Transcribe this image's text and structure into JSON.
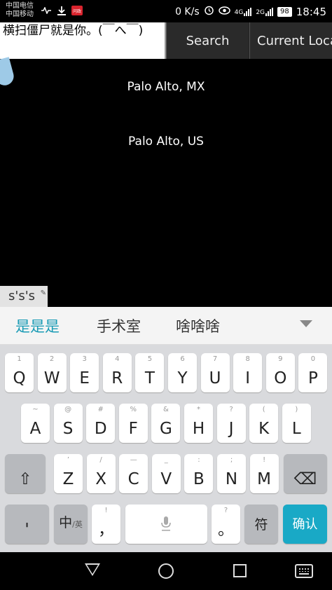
{
  "status_bar": {
    "carrier1": "中国电信",
    "carrier2": "中国移动",
    "net_speed": "0 K/s",
    "net1": "4G",
    "net2": "2G",
    "battery": "98",
    "time": "18:45",
    "icons": [
      "pulse-icon",
      "download-icon",
      "app-badge-icon",
      "alarm-icon",
      "eye-icon",
      "signal-icon",
      "battery-icon"
    ],
    "app_badge_text": "问政"
  },
  "top_bar": {
    "input_value": "横扫僵尸就是你。(￣へ￣)",
    "search_label": "Search",
    "location_label": "Current Location"
  },
  "results": [
    {
      "label": "Palo Alto, MX"
    },
    {
      "label": "Palo Alto, US"
    }
  ],
  "ime": {
    "composing": "s's's",
    "candidates": [
      "是是是",
      "手术室",
      "啥啥啥"
    ],
    "accent_color": "#19a9c6"
  },
  "keyboard": {
    "row1": [
      {
        "hint": "1",
        "label": "Q"
      },
      {
        "hint": "2",
        "label": "W"
      },
      {
        "hint": "3",
        "label": "E"
      },
      {
        "hint": "4",
        "label": "R"
      },
      {
        "hint": "5",
        "label": "T"
      },
      {
        "hint": "6",
        "label": "Y"
      },
      {
        "hint": "7",
        "label": "U"
      },
      {
        "hint": "8",
        "label": "I"
      },
      {
        "hint": "9",
        "label": "O"
      },
      {
        "hint": "0",
        "label": "P"
      }
    ],
    "row2": [
      {
        "hint": "~",
        "label": "A"
      },
      {
        "hint": "@",
        "label": "S"
      },
      {
        "hint": "#",
        "label": "D"
      },
      {
        "hint": "%",
        "label": "F"
      },
      {
        "hint": "&",
        "label": "G"
      },
      {
        "hint": "*",
        "label": "H"
      },
      {
        "hint": "?",
        "label": "J"
      },
      {
        "hint": "(",
        "label": "K"
      },
      {
        "hint": ")",
        "label": "L"
      }
    ],
    "row3": [
      {
        "hint": "’",
        "label": "Z"
      },
      {
        "hint": "/",
        "label": "X"
      },
      {
        "hint": "—",
        "label": "C"
      },
      {
        "hint": "_",
        "label": "V"
      },
      {
        "hint": ":",
        "label": "B"
      },
      {
        "hint": ";",
        "label": "N"
      },
      {
        "hint": "!",
        "label": "M"
      }
    ],
    "shift": "⇧",
    "backspace": "⌫",
    "symbols": "'",
    "lang_main": "中",
    "lang_sub": "/英",
    "comma_hint": "!",
    "comma": "，",
    "space": "🎤",
    "period_hint": "?",
    "period": "。",
    "sym": "符",
    "enter": "确认"
  },
  "nav_bar": {
    "icons": [
      "back-icon",
      "home-icon",
      "recent-apps-icon",
      "keyboard-icon"
    ]
  }
}
